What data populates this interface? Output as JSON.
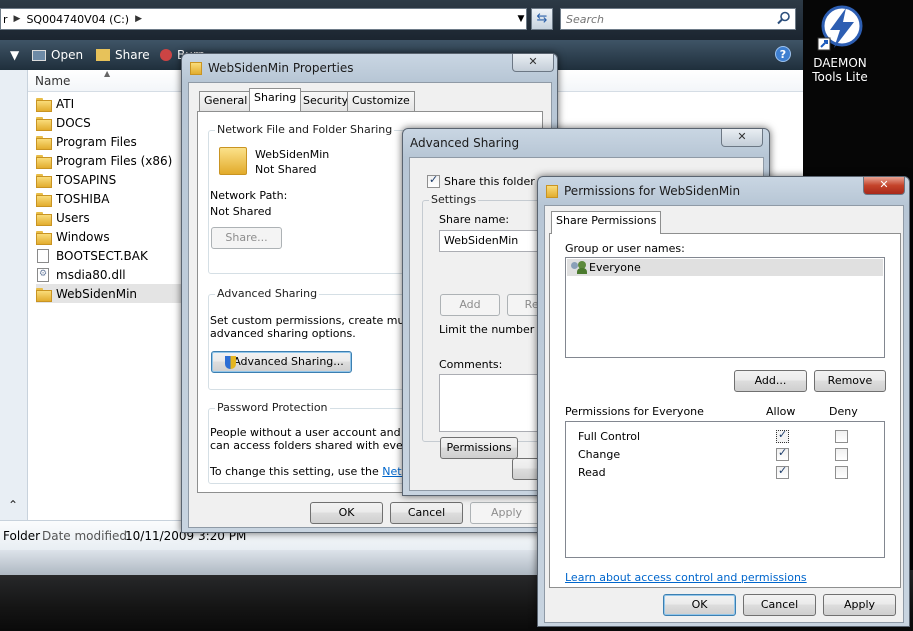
{
  "explorer": {
    "breadcrumb_prev": "r",
    "breadcrumb_current": "SQ004740V04 (C:)",
    "search_placeholder": "Search",
    "toolbar": {
      "open": "Open",
      "share": "Share",
      "burn": "Burn"
    },
    "column_name": "Name",
    "files": [
      {
        "name": "ATI",
        "type": "folder"
      },
      {
        "name": "DOCS",
        "type": "folder"
      },
      {
        "name": "Program Files",
        "type": "folder"
      },
      {
        "name": "Program Files (x86)",
        "type": "folder"
      },
      {
        "name": "TOSAPINS",
        "type": "folder"
      },
      {
        "name": "TOSHIBA",
        "type": "folder"
      },
      {
        "name": "Users",
        "type": "folder"
      },
      {
        "name": "Windows",
        "type": "folder"
      },
      {
        "name": "BOOTSECT.BAK",
        "type": "file"
      },
      {
        "name": "msdia80.dll",
        "type": "dll"
      },
      {
        "name": "WebSidenMin",
        "type": "folder",
        "selected": true
      }
    ],
    "details": {
      "type": "Folder",
      "date_label": "Date modified:",
      "date_value": "10/11/2009 3:20 PM"
    }
  },
  "desktop_icon": {
    "label_line1": "DAEMON",
    "label_line2": "Tools Lite"
  },
  "properties": {
    "title": "WebSidenMin Properties",
    "tabs": [
      "General",
      "Sharing",
      "Security",
      "Customize"
    ],
    "active_tab": "Sharing",
    "network_sharing_heading": "Network File and Folder Sharing",
    "folder_name": "WebSidenMin",
    "folder_status": "Not Shared",
    "network_path_label": "Network Path:",
    "network_path_value": "Not Shared",
    "share_button": "Share...",
    "advanced_heading": "Advanced Sharing",
    "advanced_desc_1": "Set custom permissions, create multiple",
    "advanced_desc_2": "advanced sharing options.",
    "advanced_button": "Advanced Sharing...",
    "password_heading": "Password Protection",
    "password_desc_1": "People without a user account and pas",
    "password_desc_2": "can access folders shared with everyo",
    "password_change": "To change this setting, use the",
    "password_link": "Networ",
    "ok": "OK",
    "cancel": "Cancel",
    "apply": "Apply"
  },
  "advanced": {
    "title": "Advanced Sharing",
    "share_this_folder": "Share this folder",
    "settings_label": "Settings",
    "share_name_label": "Share name:",
    "share_name_value": "WebSidenMin",
    "add_button": "Add",
    "remove_button": "Rem",
    "limit_text": "Limit the number of",
    "comments_label": "Comments:",
    "permissions_button": "Permissions"
  },
  "permissions": {
    "title": "Permissions for WebSidenMin",
    "tab": "Share Permissions",
    "group_label": "Group or user names:",
    "users": [
      "Everyone"
    ],
    "add_button": "Add...",
    "remove_button": "Remove",
    "perm_header": "Permissions for Everyone",
    "allow_header": "Allow",
    "deny_header": "Deny",
    "rows": [
      {
        "name": "Full Control",
        "allow": true,
        "deny": false
      },
      {
        "name": "Change",
        "allow": true,
        "deny": false
      },
      {
        "name": "Read",
        "allow": true,
        "deny": false
      }
    ],
    "learn_link": "Learn about access control and permissions",
    "ok": "OK",
    "cancel": "Cancel",
    "apply": "Apply"
  }
}
